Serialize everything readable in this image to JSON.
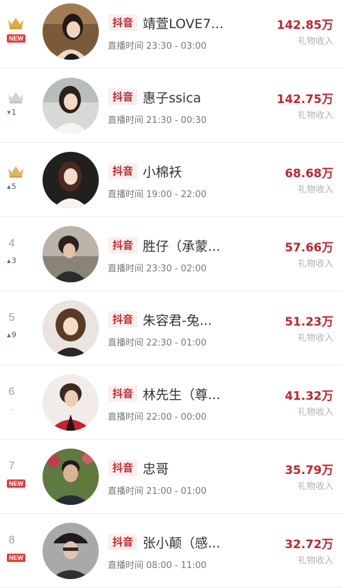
{
  "colors": {
    "accent_red": "#c0262c",
    "platform_bg": "#fbeeee",
    "crown_gold": "#e0ad3c",
    "crown_silver": "#d3d3d3",
    "new_badge": "#e83a36",
    "up_arrow": "#3f67c8",
    "down_arrow": "#2aa52a"
  },
  "rows": [
    {
      "rank": "",
      "rank_icon": "crown-gold-icon",
      "change": "",
      "change_dir": "new",
      "new_label": "NEW",
      "platform": "抖音",
      "name": "靖萱LOVE7...",
      "time": "直播时间 23:30 - 03:00",
      "value": "142.85万",
      "value_label": "礼物收入"
    },
    {
      "rank": "",
      "rank_icon": "crown-silver-icon",
      "change": "1",
      "change_dir": "down",
      "new_label": "",
      "platform": "抖音",
      "name": "惠子ssica",
      "time": "直播时间 21:30 - 00:30",
      "value": "142.75万",
      "value_label": "礼物收入"
    },
    {
      "rank": "",
      "rank_icon": "crown-bronze-icon",
      "change": "5",
      "change_dir": "up",
      "new_label": "",
      "platform": "抖音",
      "name": "小棉袄",
      "time": "直播时间 19:00 - 22:00",
      "value": "68.68万",
      "value_label": "礼物收入"
    },
    {
      "rank": "4",
      "rank_icon": "",
      "change": "3",
      "change_dir": "up",
      "new_label": "",
      "platform": "抖音",
      "name": "胜仔（承蒙...",
      "time": "直播时间 23:30 - 02:00",
      "value": "57.66万",
      "value_label": "礼物收入"
    },
    {
      "rank": "5",
      "rank_icon": "",
      "change": "9",
      "change_dir": "up",
      "new_label": "",
      "platform": "抖音",
      "name": "朱容君-兔...",
      "time": "直播时间 22:30 - 01:00",
      "value": "51.23万",
      "value_label": "礼物收入"
    },
    {
      "rank": "6",
      "rank_icon": "",
      "change": "-",
      "change_dir": "flat",
      "new_label": "",
      "platform": "抖音",
      "name": "林先生（尊...",
      "time": "直播时间 22:00 - 00:00",
      "value": "41.32万",
      "value_label": "礼物收入"
    },
    {
      "rank": "7",
      "rank_icon": "",
      "change": "",
      "change_dir": "new",
      "new_label": "NEW",
      "platform": "抖音",
      "name": "忠哥",
      "time": "直播时间 21:00 - 01:00",
      "value": "35.79万",
      "value_label": "礼物收入"
    },
    {
      "rank": "8",
      "rank_icon": "",
      "change": "",
      "change_dir": "new",
      "new_label": "NEW",
      "platform": "抖音",
      "name": "张小颠（感...",
      "time": "直播时间 08:00 - 11:00",
      "value": "32.72万",
      "value_label": "礼物收入"
    }
  ]
}
